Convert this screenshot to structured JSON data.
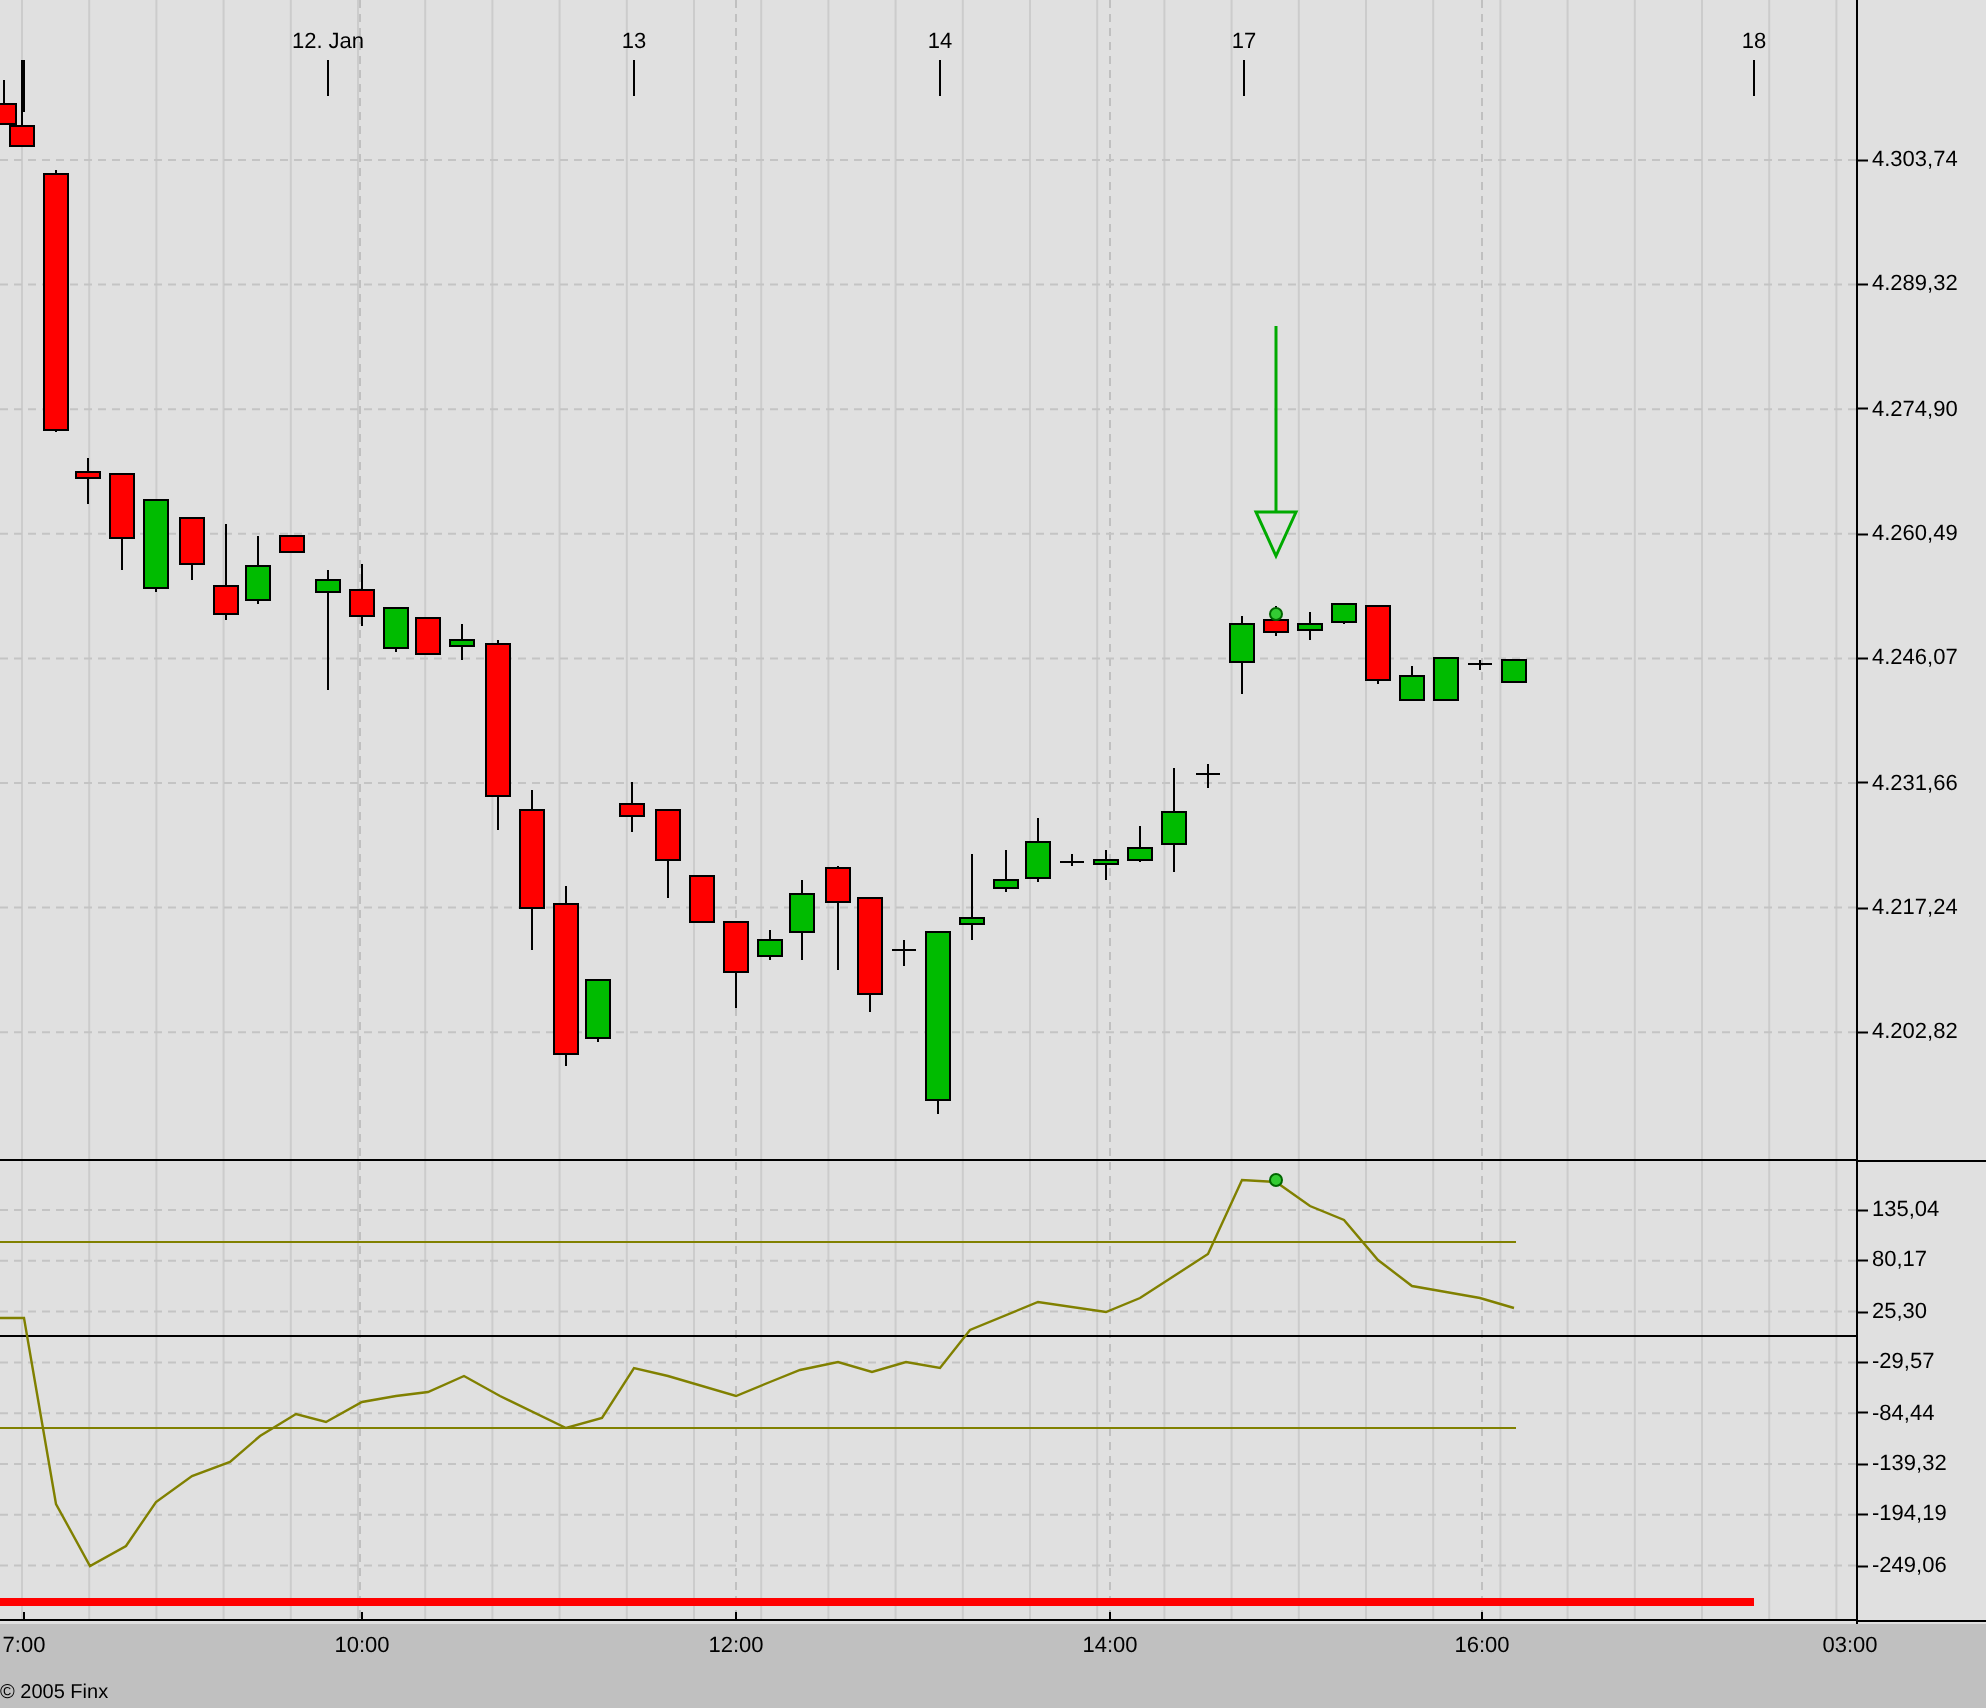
{
  "date_axis": [
    "12. Jan",
    "13",
    "14",
    "17",
    "18"
  ],
  "price_axis": [
    "4.303,74",
    "4.289,32",
    "4.274,90",
    "4.260,49",
    "4.246,07",
    "4.231,66",
    "4.217,24",
    "4.202,82"
  ],
  "indicator_axis": [
    "135,04",
    "80,17",
    "25,30",
    "-29,57",
    "-84,44",
    "-139,32",
    "-194,19",
    "-249,06"
  ],
  "time_axis": [
    "7:00",
    "10:00",
    "12:00",
    "14:00",
    "16:00",
    "03:00"
  ],
  "footer": {
    "copyright": "© 2005 Finx"
  }
}
